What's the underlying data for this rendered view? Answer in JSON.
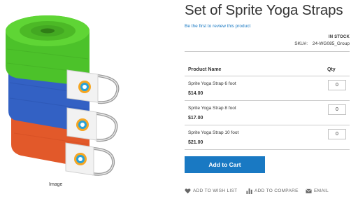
{
  "product": {
    "title": "Set of Sprite Yoga Straps",
    "review_link": "Be the first to review this product",
    "stock_status": "IN STOCK",
    "sku_label": "SKU#:",
    "sku_value": "24-WG085_Group"
  },
  "gallery": {
    "caption": "Image",
    "strap_colors": [
      "#4cc22a",
      "#3361c4",
      "#e2592a"
    ]
  },
  "table": {
    "col_product": "Product Name",
    "col_qty": "Qty",
    "rows": [
      {
        "name": "Sprite Yoga Strap 6 foot",
        "price": "$14.00",
        "qty": "0"
      },
      {
        "name": "Sprite Yoga Strap 8 foot",
        "price": "$17.00",
        "qty": "0"
      },
      {
        "name": "Sprite Yoga Strap 10 foot",
        "price": "$21.00",
        "qty": "0"
      }
    ]
  },
  "actions": {
    "add_to_cart": "Add to Cart",
    "wishlist": "ADD TO WISH LIST",
    "compare": "ADD TO COMPARE",
    "email": "EMAIL"
  },
  "colors": {
    "accent": "#1979c3"
  },
  "icons": {
    "wishlist": "heart-icon",
    "compare": "bar-chart-icon",
    "email": "envelope-icon"
  }
}
